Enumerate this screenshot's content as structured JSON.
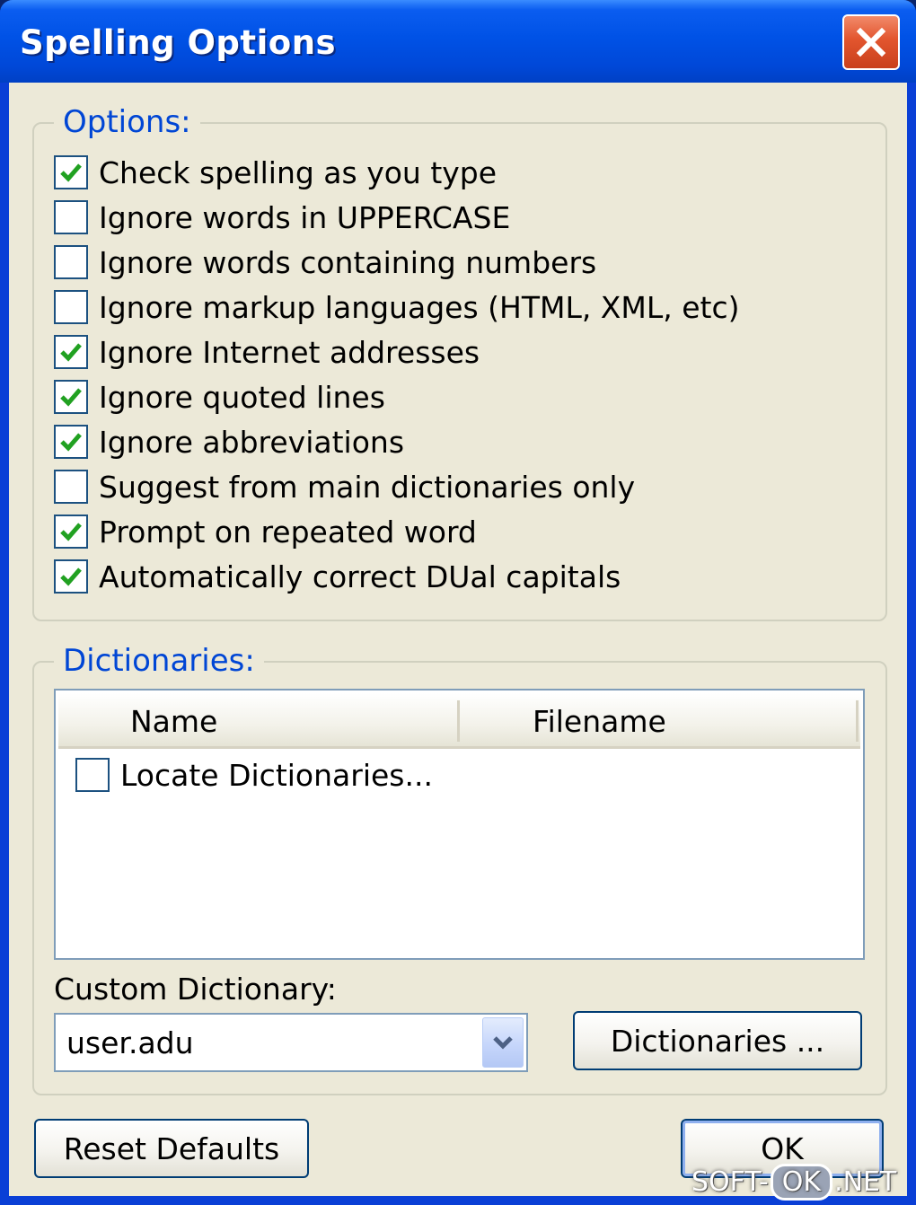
{
  "window": {
    "title": "Spelling Options"
  },
  "options_group": {
    "legend": "Options:",
    "items": [
      {
        "label": "Check spelling as you type",
        "checked": true
      },
      {
        "label": "Ignore words in UPPERCASE",
        "checked": false
      },
      {
        "label": "Ignore words containing numbers",
        "checked": false
      },
      {
        "label": "Ignore markup languages (HTML, XML, etc)",
        "checked": false
      },
      {
        "label": "Ignore Internet addresses",
        "checked": true
      },
      {
        "label": "Ignore quoted lines",
        "checked": true
      },
      {
        "label": "Ignore abbreviations",
        "checked": true
      },
      {
        "label": "Suggest from main dictionaries only",
        "checked": false
      },
      {
        "label": "Prompt on repeated word",
        "checked": true
      },
      {
        "label": "Automatically correct DUal capitals",
        "checked": true
      }
    ]
  },
  "dictionaries_group": {
    "legend": "Dictionaries:",
    "columns": [
      "Name",
      "Filename"
    ],
    "rows": [
      {
        "name": "Locate Dictionaries...",
        "checked": false
      }
    ],
    "custom_label": "Custom Dictionary:",
    "custom_value": "user.adu",
    "dictionaries_button": "Dictionaries ..."
  },
  "footer": {
    "reset_button": "Reset Defaults",
    "ok_button": "OK"
  },
  "watermark": {
    "left": "SOFT-",
    "mid": "OK",
    "right": ".NET"
  },
  "colors": {
    "title_bar": "#0052e6",
    "close_button": "#e2552e",
    "dialog_face": "#ece9d8",
    "legend_text": "#0046d5",
    "check_mark": "#21a121"
  },
  "icons": {
    "close": "close-icon",
    "combo": "chevron-down-icon",
    "check": "check-icon"
  }
}
